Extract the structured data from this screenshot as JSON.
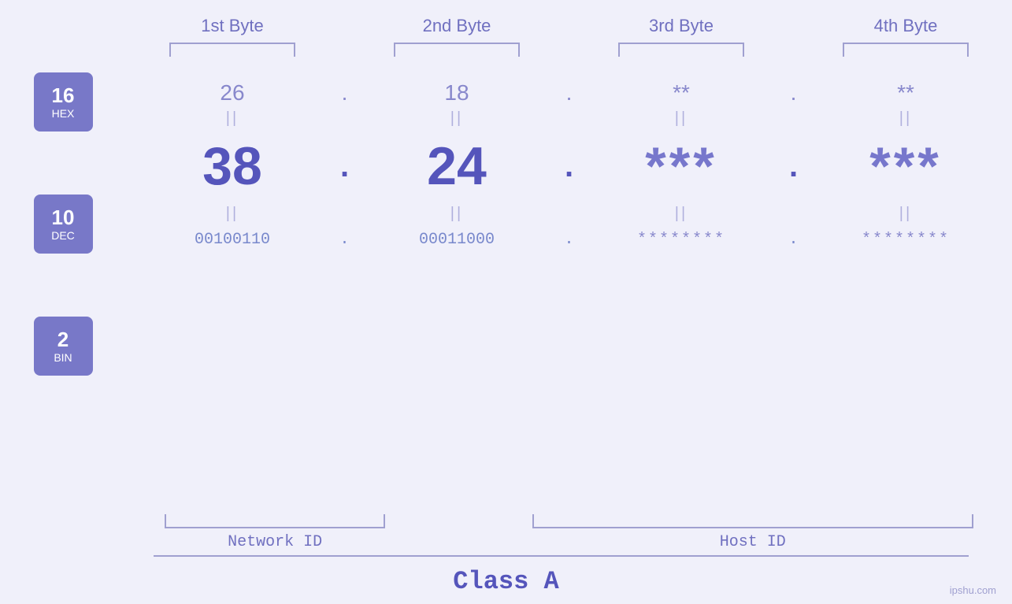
{
  "header": {
    "byte1_label": "1st Byte",
    "byte2_label": "2nd Byte",
    "byte3_label": "3rd Byte",
    "byte4_label": "4th Byte"
  },
  "badges": {
    "hex": {
      "number": "16",
      "label": "HEX"
    },
    "dec": {
      "number": "10",
      "label": "DEC"
    },
    "bin": {
      "number": "2",
      "label": "BIN"
    }
  },
  "hex_row": {
    "b1": "26",
    "b2": "18",
    "b3": "**",
    "b4": "**",
    "sep": "."
  },
  "dec_row": {
    "b1": "38",
    "b2": "24",
    "b3": "***",
    "b4": "***",
    "sep": "."
  },
  "bin_row": {
    "b1": "00100110",
    "b2": "00011000",
    "b3": "********",
    "b4": "********",
    "sep": "."
  },
  "brackets": {
    "network_id": "Network ID",
    "host_id": "Host ID",
    "class": "Class A"
  },
  "watermark": "ipshu.com"
}
